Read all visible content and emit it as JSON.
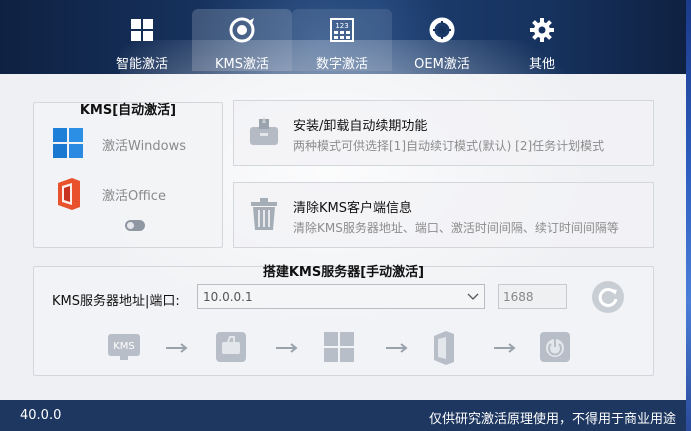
{
  "tabs": [
    {
      "label": "智能激活",
      "icon": "grid-icon"
    },
    {
      "label": "KMS激活",
      "icon": "kms-disc-icon"
    },
    {
      "label": "数字激活",
      "icon": "digital-123-icon"
    },
    {
      "label": "OEM激活",
      "icon": "lifebuoy-icon"
    },
    {
      "label": "其他",
      "icon": "gear-icon"
    }
  ],
  "active_tab": "KMS激活",
  "kms_auto": {
    "title": "KMS[自动激活]",
    "windows_label": "激活Windows",
    "office_label": "激活Office"
  },
  "functions": [
    {
      "title": "安装/卸载自动续期功能",
      "desc": "两种模式可供选择[1]自动续订模式(默认) [2]任务计划模式",
      "icon": "toolbox-icon"
    },
    {
      "title": "清除KMS客户端信息",
      "desc": "清除KMS服务器地址、端口、激活时间间隔、续订时间间隔等",
      "icon": "trash-icon"
    }
  ],
  "server": {
    "title": "搭建KMS服务器[手动激活]",
    "address_label": "KMS服务器地址|端口:",
    "address_value": "10.0.0.1",
    "port_value": "1688",
    "flow_steps": [
      "kms-server-icon",
      "toolkit-icon",
      "windows-icon",
      "office-icon",
      "power-icon"
    ],
    "kms_badge": "KMS"
  },
  "footer": {
    "version": "40.0.0",
    "note": "仅供研究激活原理使用，不得用于商业用途"
  },
  "colors": {
    "header": "#16325e",
    "footer": "#1d3760",
    "accent": "#1d3760"
  }
}
